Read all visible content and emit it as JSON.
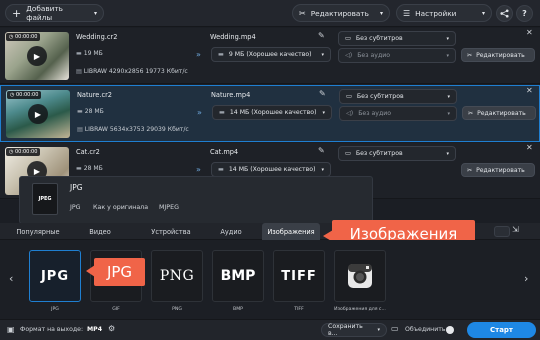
{
  "toolbar": {
    "add_files_label": "Добавить файлы",
    "edit_label": "Редактировать",
    "settings_label": "Настройки",
    "help_label": "?"
  },
  "files": [
    {
      "timecode": "00:00:00",
      "source_name": "Wedding.cr2",
      "source_size": "19 МБ",
      "source_info": "LIBRAW 4290x2856 19773 Кбит/с",
      "output_name": "Wedding.mp4",
      "output_quality": "9 МБ (Хорошее качество)",
      "subtitles": "Без субтитров",
      "audio": "Без аудио",
      "edit_label": "Редактировать",
      "selected": false
    },
    {
      "timecode": "00:00:00",
      "source_name": "Nature.cr2",
      "source_size": "28 МБ",
      "source_info": "LIBRAW 5634x3753 29039 Кбит/с",
      "output_name": "Nature.mp4",
      "output_quality": "14 МБ (Хорошее качество)",
      "subtitles": "Без субтитров",
      "audio": "Без аудио",
      "edit_label": "Редактировать",
      "selected": true
    },
    {
      "timecode": "00:00:00",
      "source_name": "Cat.cr2",
      "source_size": "28 МБ",
      "source_info": "",
      "output_name": "Cat.mp4",
      "output_quality": "14 МБ (Хорошее качество)",
      "subtitles": "Без субтитров",
      "audio": "",
      "edit_label": "Редактировать",
      "selected": false
    }
  ],
  "popup": {
    "format_title": "JPG",
    "icon_text": "JPEG",
    "options": [
      "JPG",
      "Как у оригинала",
      "MJPEG"
    ]
  },
  "tabs": [
    "Популярные",
    "Видео",
    "Устройства",
    "Аудио",
    "Изображения"
  ],
  "active_tab_index": 4,
  "callouts": {
    "tab": "Изображения",
    "format": "JPG"
  },
  "formats": [
    {
      "icon_text": "JPG",
      "label": "JPG",
      "selected": true
    },
    {
      "icon_text": "",
      "label": "GIF",
      "selected": false
    },
    {
      "icon_text": "PNG",
      "label": "PNG",
      "selected": false
    },
    {
      "icon_text": "BMP",
      "label": "BMP",
      "selected": false
    },
    {
      "icon_text": "TIFF",
      "label": "TIFF",
      "selected": false
    },
    {
      "icon_text": "",
      "label": "Изображения для с...",
      "selected": false
    }
  ],
  "bottom": {
    "output_format_label": "Формат на выходе:",
    "output_format_value": "MP4",
    "save_to_label": "Сохранить в...",
    "merge_label": "Объединить:",
    "start_label": "Старт"
  },
  "colors": {
    "accent_blue": "#1f7fd1",
    "callout_orange": "#f06448",
    "start_button": "#1e88e5"
  }
}
